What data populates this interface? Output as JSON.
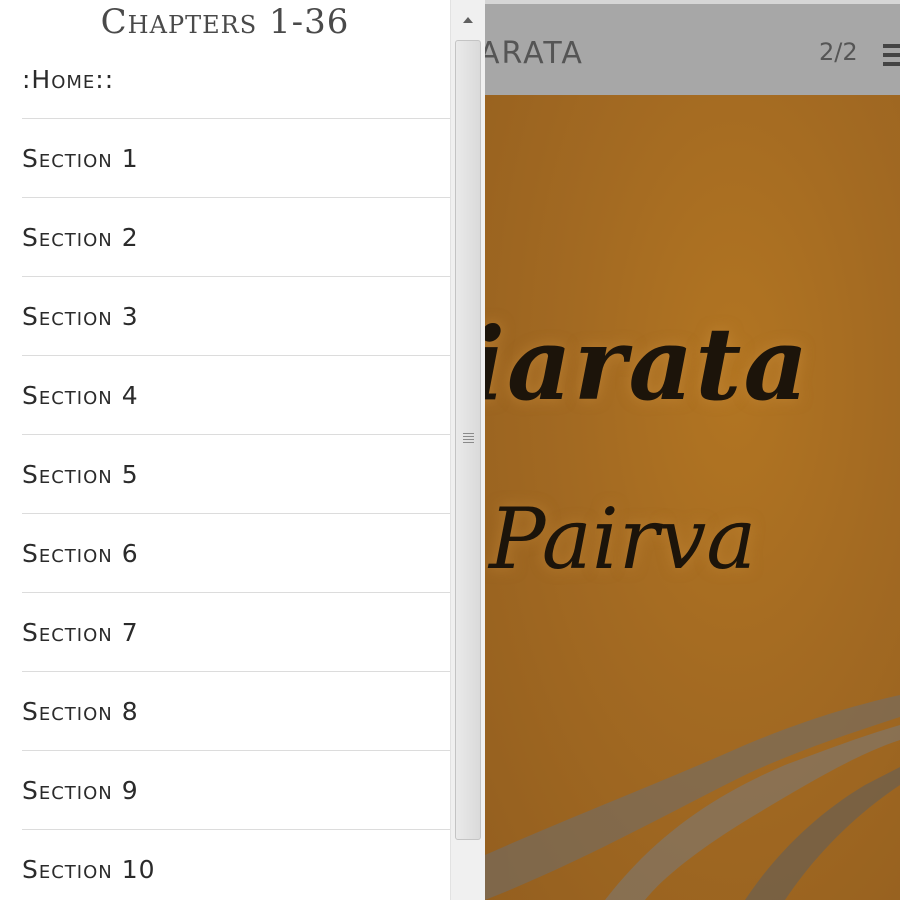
{
  "drawer": {
    "title": "Chapters 1-36",
    "items": [
      {
        "label": ":Home::"
      },
      {
        "label": "Section 1"
      },
      {
        "label": "Section 2"
      },
      {
        "label": "Section 3"
      },
      {
        "label": "Section 4"
      },
      {
        "label": "Section 5"
      },
      {
        "label": "Section 6"
      },
      {
        "label": "Section 7"
      },
      {
        "label": "Section 8"
      },
      {
        "label": "Section 9"
      },
      {
        "label": "Section 10"
      }
    ]
  },
  "reader": {
    "title_fragment": "ARATA",
    "page_counter": "2/2",
    "menu_icon": "hamburger-menu-icon",
    "cover": {
      "line1": "iarata",
      "line2": "Pairva",
      "background_color": "#a36a22",
      "text_color": "#1c140a"
    }
  },
  "colors": {
    "toolbar": "#a7a7a7",
    "drawer_background": "#ffffff",
    "divider": "#dcdcdc",
    "text": "#2b2b2b"
  }
}
